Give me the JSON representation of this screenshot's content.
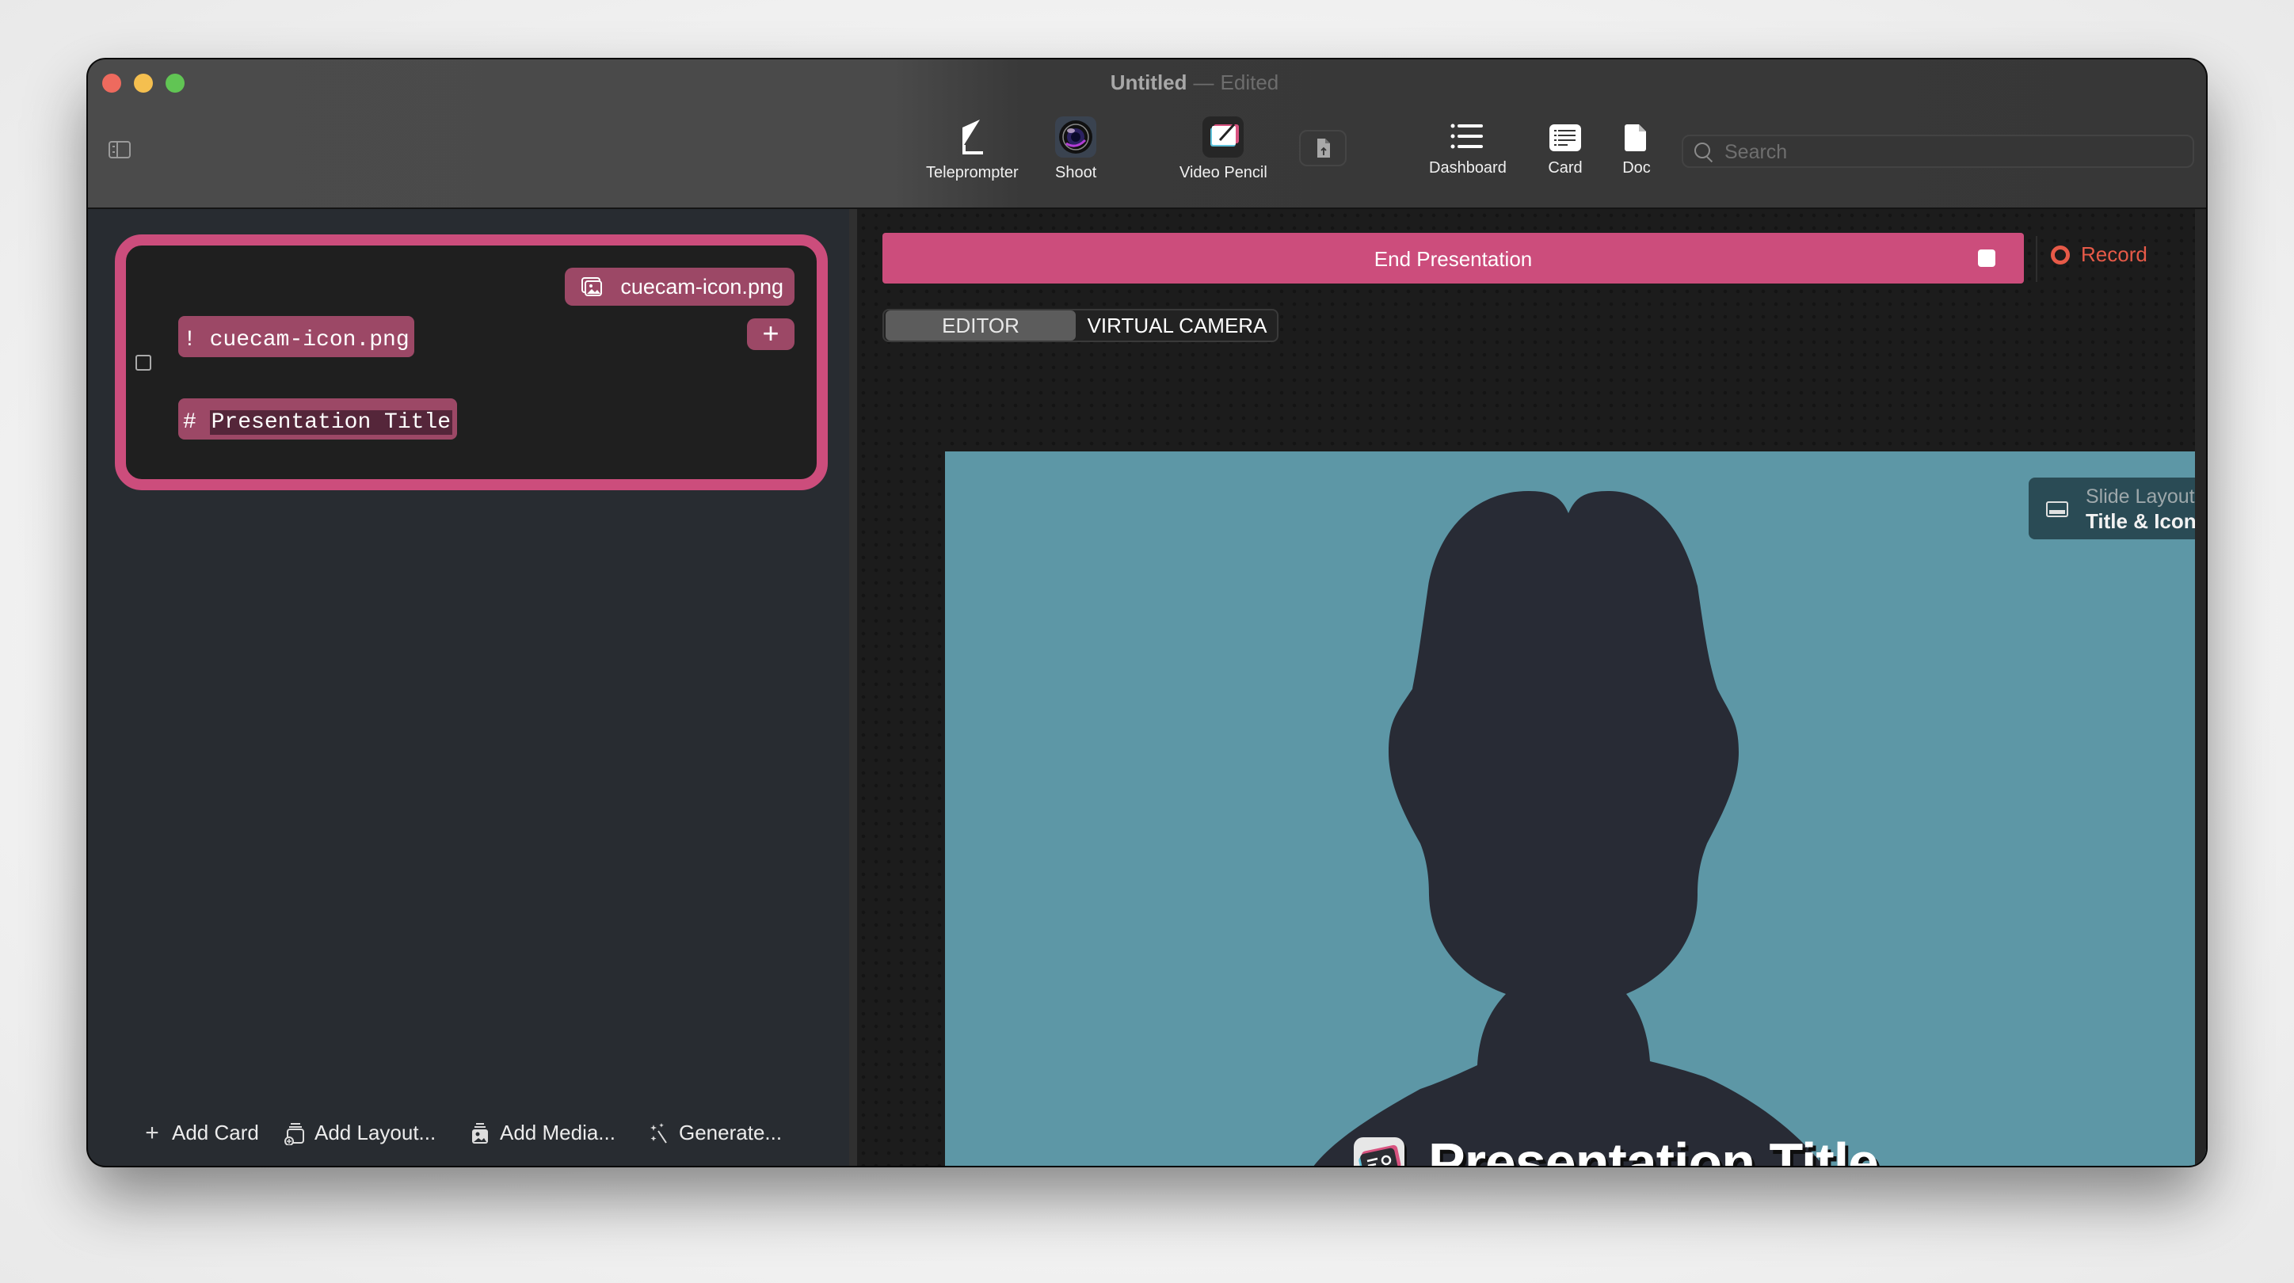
{
  "window": {
    "title": "Untitled",
    "separator": "—",
    "status": "Edited"
  },
  "toolbar": {
    "tools": [
      {
        "label": "Teleprompter",
        "icon": "teleprompter-icon"
      },
      {
        "label": "Shoot",
        "icon": "camera-lens-icon"
      },
      {
        "label": "Video Pencil",
        "icon": "video-pencil-icon"
      }
    ],
    "upload_icon": "document-upload-icon",
    "views": [
      {
        "label": "Dashboard",
        "icon": "list-icon"
      },
      {
        "label": "Card",
        "icon": "card-icon"
      },
      {
        "label": "Doc",
        "icon": "document-icon"
      }
    ],
    "search": {
      "placeholder": "Search",
      "value": ""
    }
  },
  "sidebar": {
    "card": {
      "media_chip": "cuecam-icon.png",
      "add_label": "+",
      "lines": [
        {
          "prefix": "!",
          "text": "cuecam-icon.png"
        },
        {
          "prefix": "#",
          "text": "Presentation Title"
        }
      ]
    },
    "bottom_actions": [
      {
        "label": "Add Card",
        "icon": "plus-icon"
      },
      {
        "label": "Add Layout...",
        "icon": "add-layout-icon"
      },
      {
        "label": "Add Media...",
        "icon": "add-media-icon"
      },
      {
        "label": "Generate...",
        "icon": "magic-wand-icon"
      }
    ]
  },
  "main": {
    "end_presentation": "End Presentation",
    "record": "Record",
    "tabs": [
      {
        "label": "EDITOR",
        "active": true
      },
      {
        "label": "VIRTUAL CAMERA",
        "active": false
      }
    ],
    "slide": {
      "layout_label": "Slide Layout",
      "layout_value": "Title & Icon",
      "title": "Presentation Title",
      "background": "#5d97a6",
      "silhouette": "#282b35"
    }
  },
  "colors": {
    "accent": "#cc4d7c",
    "chip": "#9c4866",
    "record": "#e75a48"
  }
}
